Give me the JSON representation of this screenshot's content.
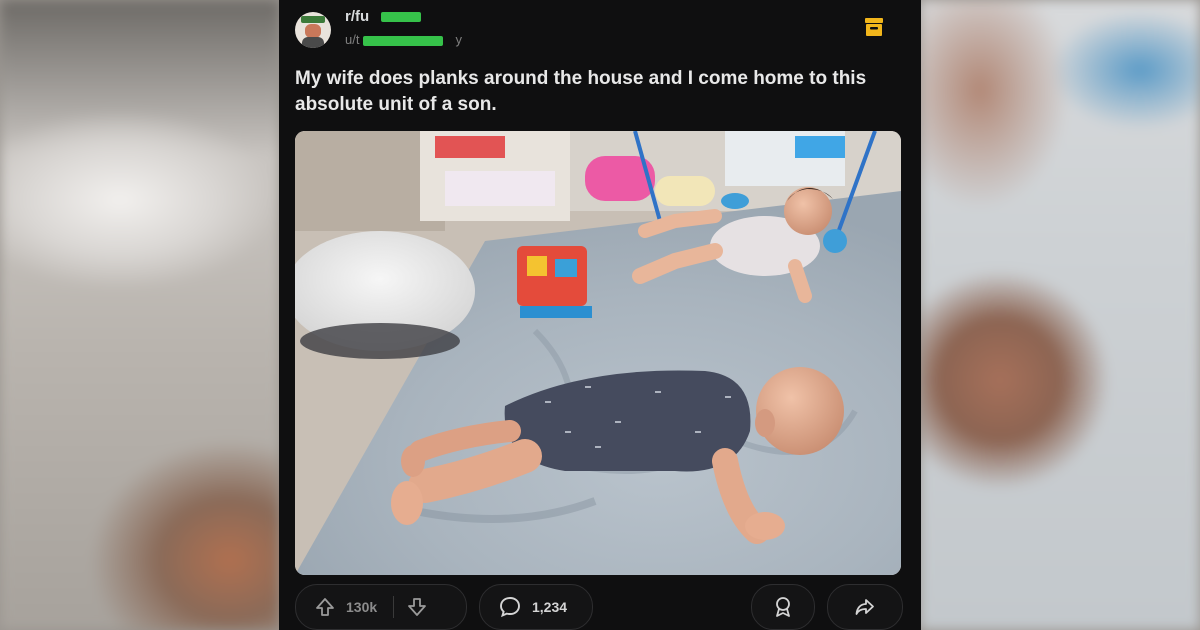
{
  "post": {
    "subreddit": "r/fu",
    "username_visible_prefix": "u/t",
    "username_visible_suffix": "y",
    "title": "My wife does planks around the house and I come home to this absolute unit of a son.",
    "upvotes": "130k",
    "comments": "1,234"
  },
  "icons": {
    "archive": "archive-icon",
    "upvote": "arrow-up-icon",
    "downvote": "arrow-down-icon",
    "comment": "comment-bubble-icon",
    "award": "award-icon",
    "share": "share-arrow-icon"
  },
  "colors": {
    "card_background": "#0f0f10",
    "archive_icon": "#f2b61b",
    "redaction": "#36c24a"
  }
}
